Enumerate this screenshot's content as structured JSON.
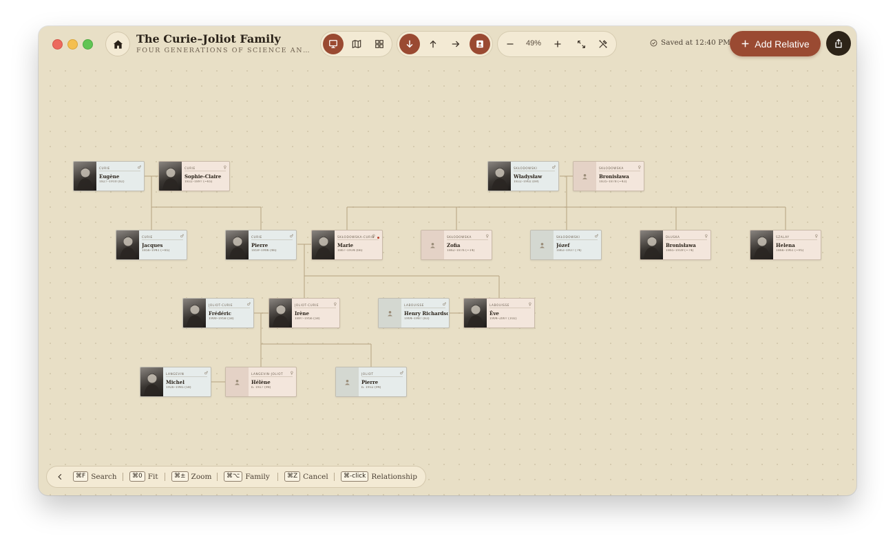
{
  "window": {
    "title": "The Curie–Joliot Family",
    "subtitle": "FOUR GENERATIONS OF SCIENCE AND PUBLIC LIFE"
  },
  "toolbar": {
    "view_buttons": [
      {
        "icon": "tree-view-icon",
        "active": true
      },
      {
        "icon": "map-icon",
        "active": false
      },
      {
        "icon": "grid-icon",
        "active": false
      }
    ],
    "direction_buttons": [
      {
        "icon": "arrow-down-icon",
        "active": true
      },
      {
        "icon": "arrow-up-icon",
        "active": false
      },
      {
        "icon": "arrow-right-icon",
        "active": false
      },
      {
        "icon": "person-card-icon",
        "active": true
      }
    ],
    "zoom": "49%",
    "saved_status": "Saved at 12:40 PM",
    "add_relative_label": "Add Relative"
  },
  "tree": {
    "people": [
      {
        "id": "eugene",
        "surname": "CURIE",
        "name": "Eugène",
        "dates": "1827–1910 (82)",
        "sex": "m",
        "photo": true,
        "symbol": "♂"
      },
      {
        "id": "sophie",
        "surname": "CURIE",
        "name": "Sophie-Claire",
        "dates": "1832–1897 (~65)",
        "sex": "f",
        "photo": true,
        "symbol": "♀"
      },
      {
        "id": "wladyslaw",
        "surname": "SKŁODOWSKI",
        "name": "Władysław",
        "dates": "1832–1902 (69)",
        "sex": "m",
        "photo": true,
        "symbol": "♂"
      },
      {
        "id": "bronislawa_sr",
        "surname": "SKŁODOWSKA",
        "name": "Bronisława",
        "dates": "1835–1878 (~43)",
        "sex": "f",
        "photo": false,
        "symbol": "♀"
      },
      {
        "id": "jacques",
        "surname": "CURIE",
        "name": "Jacques",
        "dates": "1856–1941 (~85)",
        "sex": "m",
        "photo": true,
        "symbol": "♂"
      },
      {
        "id": "pierre",
        "surname": "CURIE",
        "name": "Pierre",
        "dates": "1859–1906 (46)",
        "sex": "m",
        "photo": true,
        "symbol": "♂"
      },
      {
        "id": "marie",
        "surname": "SKŁODOWSKA-CURIE",
        "name": "Marie",
        "dates": "1867–1934 (66)",
        "sex": "f",
        "photo": true,
        "symbol": "♀",
        "flag": true
      },
      {
        "id": "zofia",
        "surname": "SKŁODOWSKA",
        "name": "Zofia",
        "dates": "1862–1876 (~14)",
        "sex": "f",
        "photo": false,
        "symbol": "♀"
      },
      {
        "id": "jozef",
        "surname": "SKŁODOWSKI",
        "name": "Józef",
        "dates": "1863–1937 (74)",
        "sex": "m",
        "photo": false,
        "symbol": "♂"
      },
      {
        "id": "bronislawa",
        "surname": "DŁUSKA",
        "name": "Bronisława",
        "dates": "1865–1939 (~74)",
        "sex": "f",
        "photo": true,
        "symbol": "♀"
      },
      {
        "id": "helena",
        "surname": "SZALAY",
        "name": "Helena",
        "dates": "1866–1961 (~95)",
        "sex": "f",
        "photo": true,
        "symbol": "♀"
      },
      {
        "id": "frederic",
        "surname": "JOLIOT-CURIE",
        "name": "Frédéric",
        "dates": "1900–1958 (58)",
        "sex": "m",
        "photo": true,
        "symbol": "♂"
      },
      {
        "id": "irene",
        "surname": "JOLIOT-CURIE",
        "name": "Irène",
        "dates": "1897–1956 (58)",
        "sex": "f",
        "photo": true,
        "symbol": "♀"
      },
      {
        "id": "henry",
        "surname": "LABOUISSE",
        "name": "Henry Richardson",
        "dates": "1904–1987 (83)",
        "sex": "m",
        "photo": false,
        "symbol": "♂"
      },
      {
        "id": "eve",
        "surname": "LABOUISSE",
        "name": "Ève",
        "dates": "1904–2007 (102)",
        "sex": "f",
        "photo": true,
        "symbol": "♀"
      },
      {
        "id": "michel",
        "surname": "LANGEVIN",
        "name": "Michel",
        "dates": "1926–1985 (58)",
        "sex": "m",
        "photo": true,
        "symbol": "♂"
      },
      {
        "id": "helene",
        "surname": "LANGEVIN-JOLIOT",
        "name": "Hélène",
        "dates": "b. 1927 (98)",
        "sex": "f",
        "photo": false,
        "symbol": "♀"
      },
      {
        "id": "pierre_joliot",
        "surname": "JOLIOT",
        "name": "Pierre",
        "dates": "b. 1932 (94)",
        "sex": "m",
        "photo": false,
        "symbol": "♂"
      }
    ]
  },
  "hints": [
    {
      "key": "⌘F",
      "label": "Search"
    },
    {
      "key": "⌘0",
      "label": "Fit"
    },
    {
      "key": "⌘±",
      "label": "Zoom"
    },
    {
      "key": "⌘⌥",
      "label": "Family"
    },
    {
      "key": "⌘Z",
      "label": "Cancel"
    },
    {
      "key": "⌘-click",
      "label": "Relationship"
    }
  ],
  "colors": {
    "accent": "#9a4a32",
    "background": "#e8dfc6",
    "male_card": "#e6eceb",
    "female_card": "#f3e6dc"
  }
}
